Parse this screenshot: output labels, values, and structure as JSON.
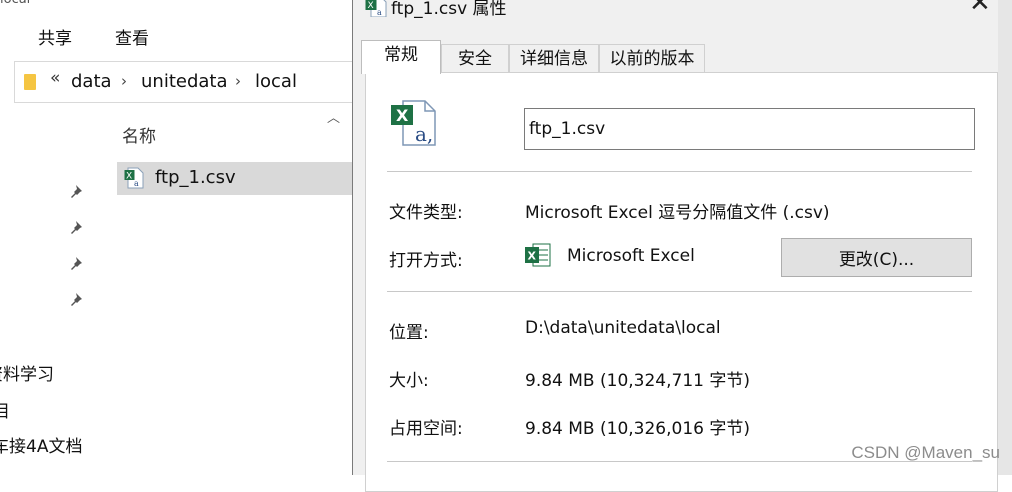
{
  "explorer": {
    "title_partial": "local",
    "ribbon_tabs": [
      "共享",
      "查看"
    ],
    "address": {
      "overflow": "«",
      "crumbs": [
        "data",
        "unitedata",
        "local"
      ]
    },
    "column_header": "名称",
    "file": {
      "name": "ftp_1.csv",
      "icon": "excel-csv-icon"
    },
    "nav_items": [
      "资料学习",
      "目",
      "车接4A文档"
    ]
  },
  "dialog": {
    "title": "ftp_1.csv 属性",
    "tabs": [
      "常规",
      "安全",
      "详细信息",
      "以前的版本"
    ],
    "active_tab": "常规",
    "file_name_value": "ftp_1.csv",
    "file_type_label": "文件类型:",
    "file_type_value": "Microsoft Excel 逗号分隔值文件 (.csv)",
    "open_with_label": "打开方式:",
    "open_with_value": "Microsoft Excel",
    "change_button": "更改(C)...",
    "location_label": "位置:",
    "location_value": "D:\\data\\unitedata\\local",
    "size_label": "大小:",
    "size_value": "9.84 MB (10,324,711 字节)",
    "disk_label": "占用空间:",
    "disk_value": "9.84 MB (10,326,016 字节)"
  },
  "watermark": "CSDN @Maven_su",
  "colors": {
    "excel_green": "#1e7145",
    "folder_yellow": "#f5c542",
    "selection": "#d9d9d9"
  }
}
